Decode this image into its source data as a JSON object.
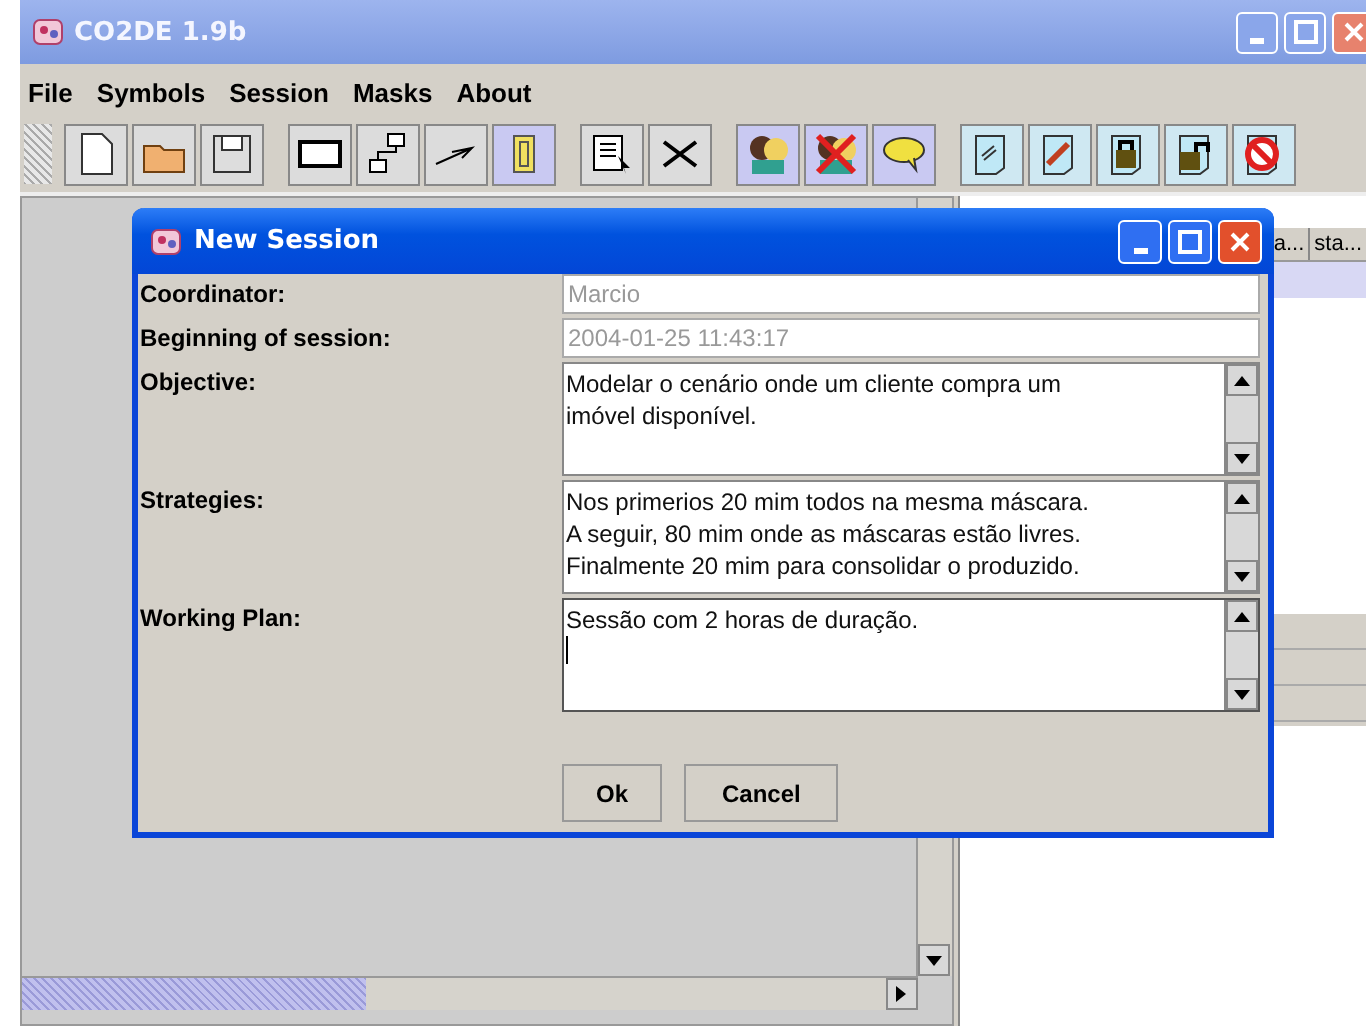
{
  "window": {
    "title": "CO2DE 1.9b"
  },
  "menu": [
    {
      "label": "File"
    },
    {
      "label": "Symbols"
    },
    {
      "label": "Session"
    },
    {
      "label": "Masks"
    },
    {
      "label": "About"
    }
  ],
  "side_table": {
    "columns": [
      "a...",
      "sta..."
    ]
  },
  "dialog": {
    "title": "New Session",
    "fields": [
      {
        "label": "Coordinator:",
        "kind": "text",
        "disabled": true,
        "lines": [
          "Marcio"
        ],
        "focused": false
      },
      {
        "label": "Beginning of session:",
        "kind": "text",
        "disabled": true,
        "lines": [
          "2004-01-25 11:43:17"
        ],
        "focused": false
      },
      {
        "label": "Objective:",
        "kind": "textarea",
        "disabled": false,
        "lines": [
          "Modelar o cenário onde um cliente compra um",
          "imóvel disponível."
        ],
        "focused": false
      },
      {
        "label": "Strategies:",
        "kind": "textarea",
        "disabled": false,
        "lines": [
          "Nos primerios 20 mim todos na mesma máscara.",
          "A seguir, 80 mim onde as máscaras estão livres.",
          "Finalmente 20 mim para consolidar o produzido."
        ],
        "focused": false
      },
      {
        "label": "Working Plan:",
        "kind": "textarea",
        "disabled": false,
        "lines": [
          "Sessão com 2 horas de duração."
        ],
        "focused": true
      }
    ],
    "buttons": [
      {
        "label": "Ok"
      },
      {
        "label": "Cancel"
      }
    ]
  }
}
